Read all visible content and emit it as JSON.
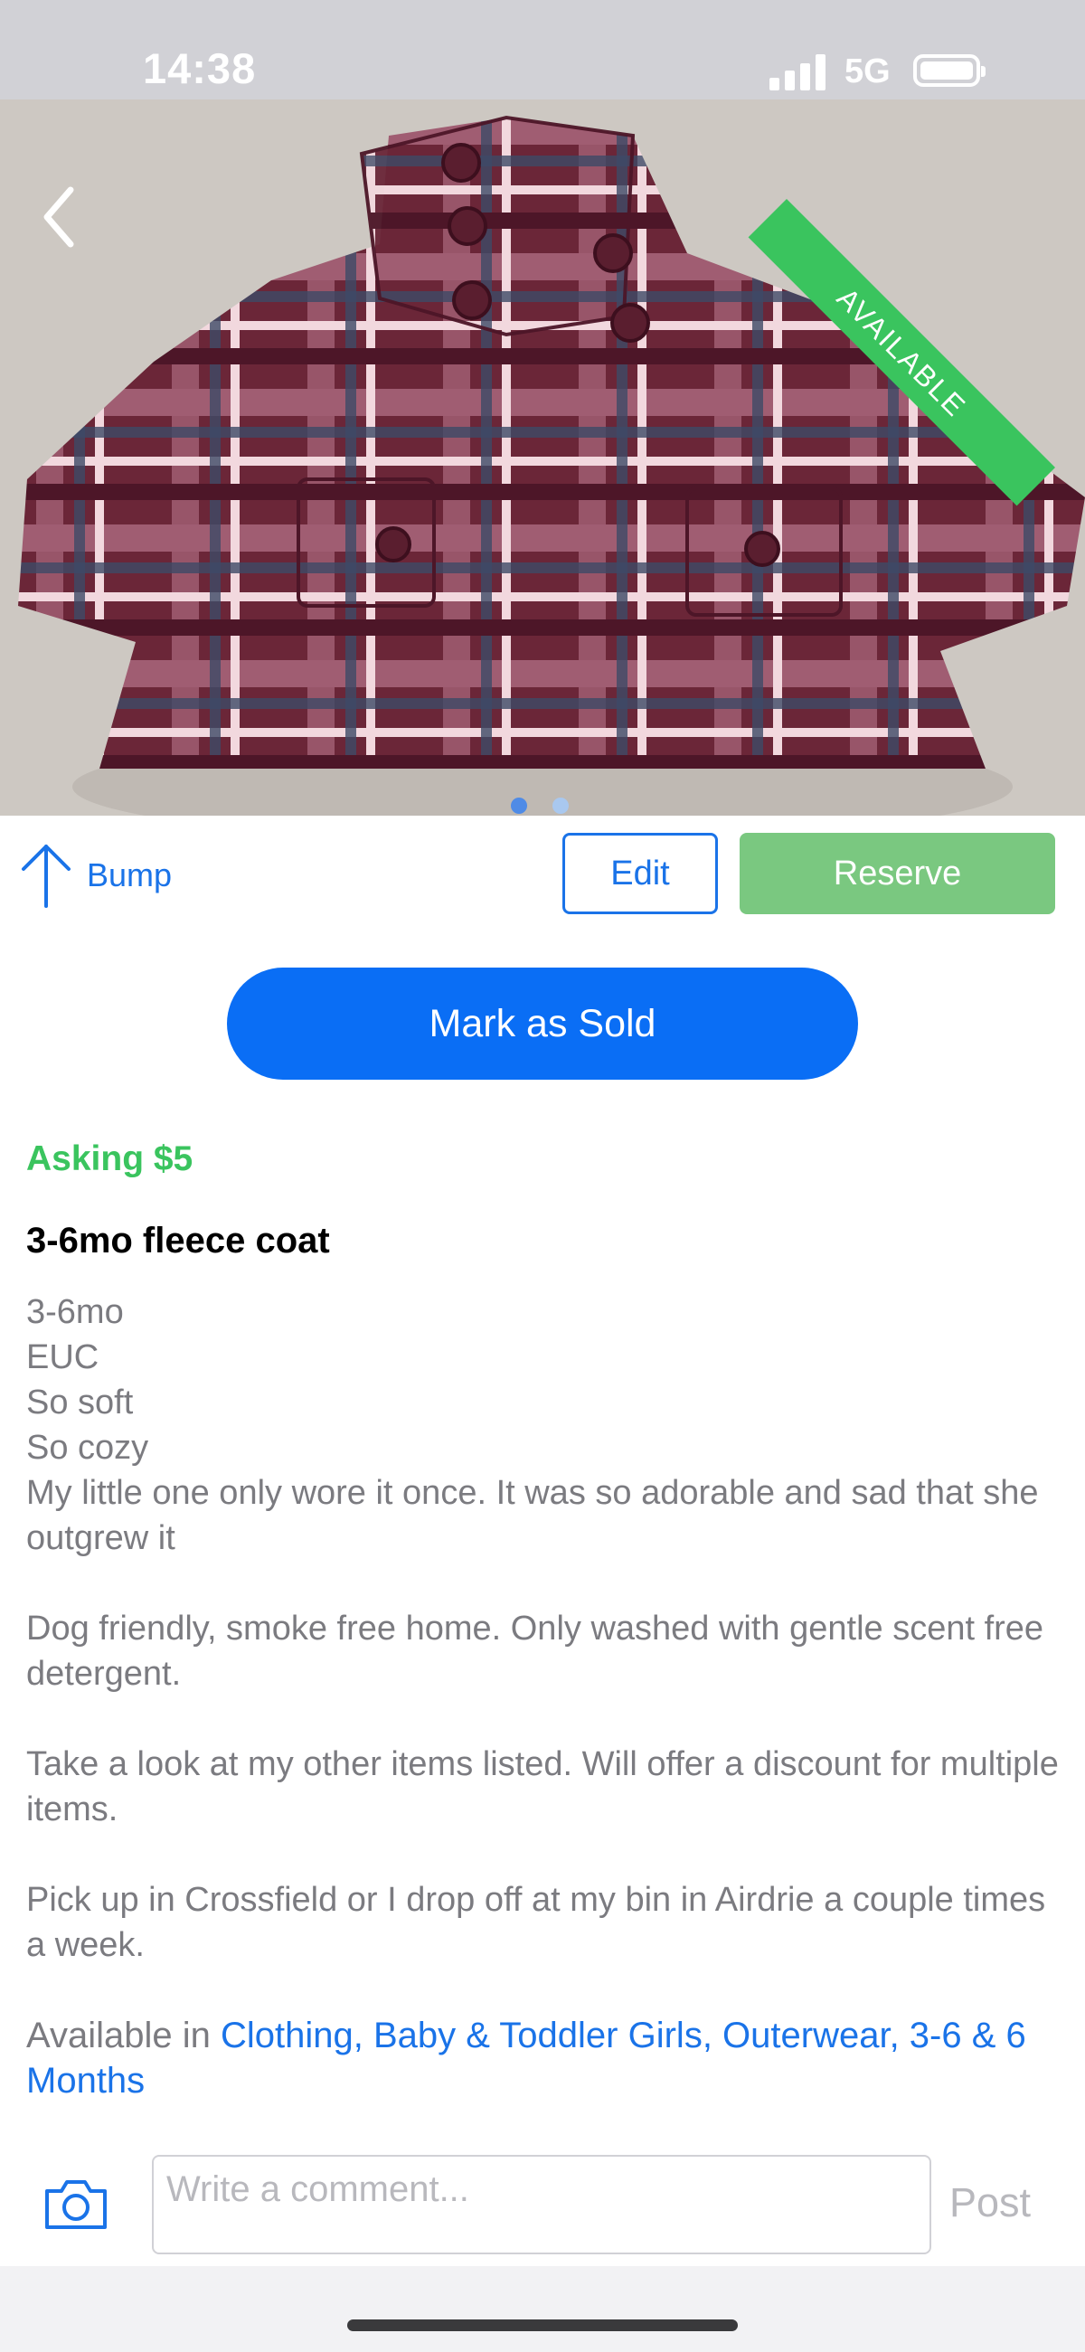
{
  "status_bar": {
    "time": "14:38",
    "network": "5G"
  },
  "photo": {
    "badge": "AVAILABLE",
    "page_count": 2,
    "current_page": 1
  },
  "actions": {
    "bump_label": "Bump",
    "edit_label": "Edit",
    "reserve_label": "Reserve",
    "sold_label": "Mark as Sold"
  },
  "listing": {
    "price": "Asking $5",
    "title": "3-6mo fleece coat",
    "description": "3-6mo\nEUC\nSo soft\nSo cozy\nMy little one only wore it once. It was so adorable and sad that she outgrew it\n\nDog friendly, smoke free home. Only washed with gentle scent free detergent.\n\nTake a look at my other items listed. Will offer a discount for multiple items.\n\nPick up in Crossfield or I drop off at my bin in Airdrie a couple times a week.",
    "categories_prefix": "Available in ",
    "categories_text": "Clothing, Baby & Toddler Girls, Outerwear, 3-6 & 6 Months"
  },
  "comment": {
    "placeholder": "Write a comment...",
    "post_label": "Post"
  },
  "colors": {
    "accent": "#1a73e8",
    "green": "#3ac45e",
    "reserve": "#7ac880",
    "primary_button": "#0a6ef5"
  }
}
